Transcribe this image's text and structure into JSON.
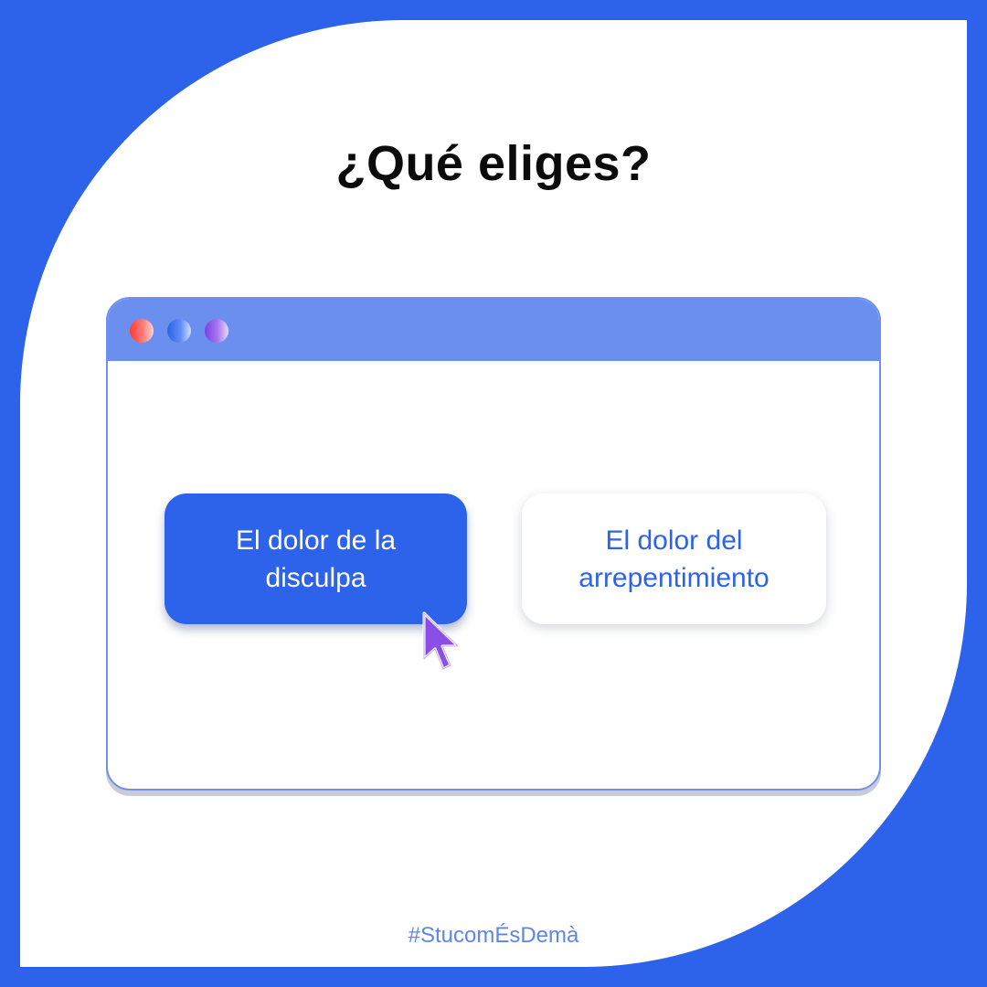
{
  "title": "¿Qué eliges?",
  "window": {
    "dots": [
      "red-dot",
      "blue-dot",
      "purple-dot"
    ]
  },
  "options": [
    {
      "label": "El dolor de la disculpa",
      "selected": true
    },
    {
      "label": "El dolor del arrepentimiento",
      "selected": false
    }
  ],
  "hashtag": "#StucomÉsDemà",
  "colors": {
    "brand_blue": "#2d63ea",
    "titlebar": "#6b8fef",
    "cursor": "#8a4fe6"
  },
  "icons": {
    "cursor": "mouse-pointer-icon"
  }
}
